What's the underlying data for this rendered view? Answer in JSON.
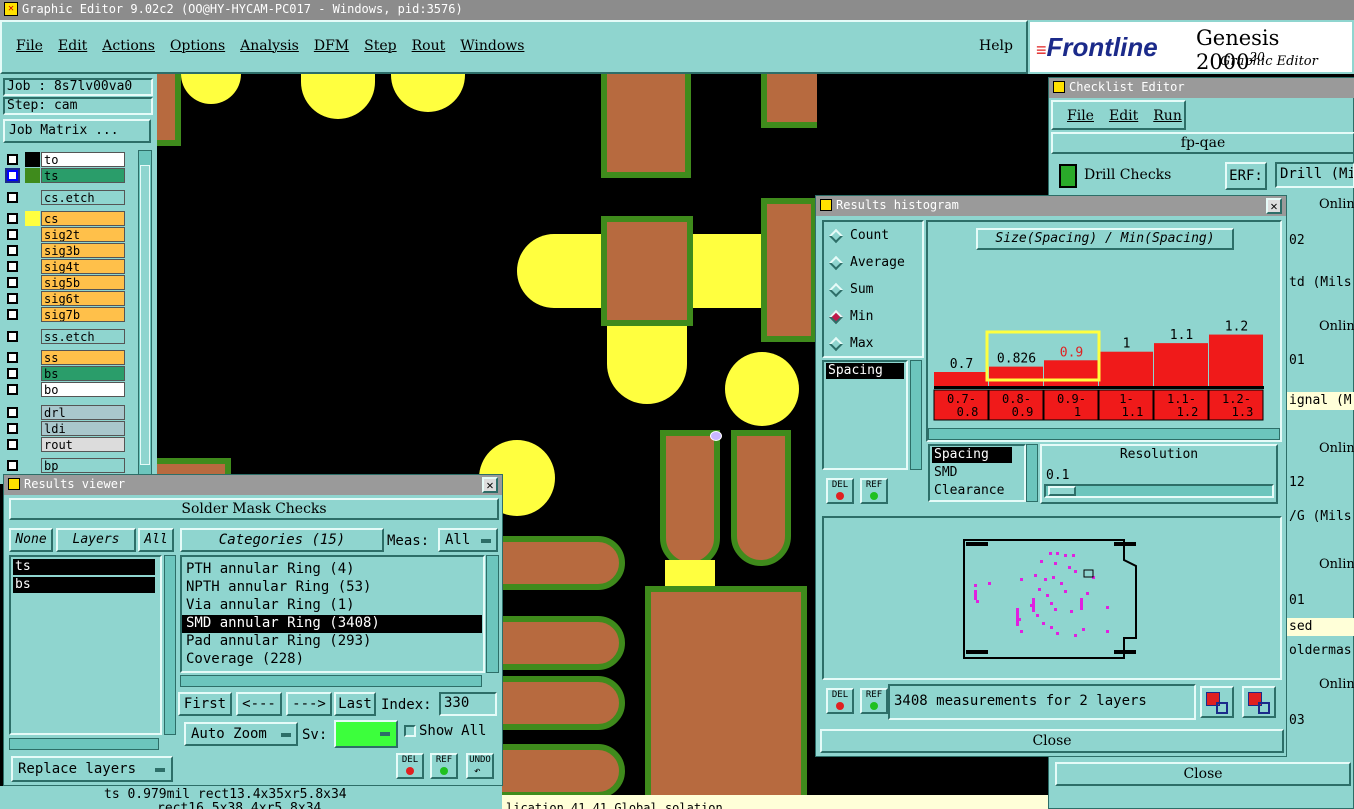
{
  "window_title": "Graphic Editor 9.02c2 (OO@HY-HYCAM-PC017 - Windows, pid:3576)",
  "menu": [
    "File",
    "Edit",
    "Actions",
    "Options",
    "Analysis",
    "DFM",
    "Step",
    "Rout",
    "Windows"
  ],
  "help": "Help",
  "brand": {
    "logo": "Frontline",
    "product": "Genesis 2000",
    "version": "20",
    "subtitle": "Graphic Editor"
  },
  "job": {
    "label": "Job : 8s7lv00va0",
    "step": "Step: cam",
    "matrix_button": "Job Matrix ..."
  },
  "layers": [
    {
      "name": "to",
      "color": "#ffffff",
      "swatch": "#000000"
    },
    {
      "name": "ts",
      "color": "#2a9d6a",
      "swatch": "#3f8b1c"
    },
    {
      "name": "cs.etch",
      "color": "#8fd5cf",
      "swatch": ""
    },
    {
      "name": "cs",
      "color": "#ffc04a",
      "swatch": "#ffff3f"
    },
    {
      "name": "sig2t",
      "color": "#ffc04a",
      "swatch": ""
    },
    {
      "name": "sig3b",
      "color": "#ffc04a",
      "swatch": ""
    },
    {
      "name": "sig4t",
      "color": "#ffc04a",
      "swatch": ""
    },
    {
      "name": "sig5b",
      "color": "#ffc04a",
      "swatch": ""
    },
    {
      "name": "sig6t",
      "color": "#ffc04a",
      "swatch": ""
    },
    {
      "name": "sig7b",
      "color": "#ffc04a",
      "swatch": ""
    },
    {
      "name": "ss.etch",
      "color": "#8fd5cf",
      "swatch": ""
    },
    {
      "name": "ss",
      "color": "#ffc04a",
      "swatch": ""
    },
    {
      "name": "bs",
      "color": "#2a9d6a",
      "swatch": ""
    },
    {
      "name": "bo",
      "color": "#ffffff",
      "swatch": ""
    },
    {
      "name": "drl",
      "color": "#a9c7cc",
      "swatch": ""
    },
    {
      "name": "ldi",
      "color": "#a9c7cc",
      "swatch": ""
    },
    {
      "name": "rout",
      "color": "#dcdcdc",
      "swatch": ""
    },
    {
      "name": "bp",
      "color": "#8fd5cf",
      "swatch": ""
    }
  ],
  "results_viewer": {
    "title": "Results viewer",
    "header": "Solder Mask Checks",
    "none_btn": "None",
    "layers_btn": "Layers",
    "all_btn": "All",
    "layer_list": [
      "ts",
      "bs"
    ],
    "categories_btn": "Categories (15)",
    "meas_label": "Meas:",
    "meas_value": "All",
    "categories": [
      "PTH annular Ring (4)",
      "NPTH annular Ring (53)",
      "Via annular Ring (1)",
      "SMD annular Ring (3408)",
      "Pad annular Ring (293)",
      "Coverage (228)"
    ],
    "selected_category": 3,
    "first": "First",
    "prev": "<---",
    "next": "--->",
    "last": "Last",
    "index_label": "Index:",
    "index_value": "330",
    "auto_zoom": "Auto Zoom",
    "sv_label": "Sv:",
    "show_all": "Show All",
    "replace_layers": "Replace layers",
    "del": "DEL",
    "ref": "REF",
    "undo": "UNDO"
  },
  "status": {
    "line1": "ts 0.979mil  rect13.4x35xr5.8x34",
    "line2": "rect16.5x38.4xr5.8x34",
    "bottom": "lication 41.41 Global solation"
  },
  "checklist": {
    "title": "Checklist Editor",
    "menu": [
      "File",
      "Edit",
      "Run"
    ],
    "name": "fp-qae",
    "drill_checks": "Drill Checks",
    "erf_label": "ERF:",
    "erf_value": "Drill (Mi",
    "side_labels": [
      "Onlin",
      "02",
      "td (Mils",
      "Onlin",
      "01",
      "ignal (M",
      "Onlin",
      "12",
      "/G (Mils",
      "Onlin",
      "01",
      "sed",
      "oldermas",
      "Onlin",
      "03"
    ],
    "close": "Close"
  },
  "histogram": {
    "title": "Results histogram",
    "modes": [
      "Count",
      "Average",
      "Sum",
      "Min",
      "Max"
    ],
    "selected_mode": "Min",
    "chart_title": "Size(Spacing) / Min(Spacing)",
    "measure_list": [
      "Spacing"
    ],
    "type_list": [
      "Spacing",
      "SMD",
      "Clearance"
    ],
    "resolution_label": "Resolution",
    "resolution_value": "0.1",
    "summary": "3408 measurements for 2 layers",
    "close": "Close",
    "del": "DEL",
    "ref": "REF"
  },
  "chart_data": {
    "type": "bar",
    "title": "Size(Spacing) / Min(Spacing)",
    "categories": [
      "0.7-0.8",
      "0.8-0.9",
      "0.9-1",
      "1-1.1",
      "1.1-1.2",
      "1.2-1.3"
    ],
    "value_labels": [
      "0.7",
      "0.826",
      "0.9",
      "1",
      "1.1",
      "1.2"
    ],
    "values": [
      0.7,
      0.826,
      0.9,
      1.0,
      1.1,
      1.2
    ],
    "highlighted": [
      1,
      2
    ],
    "bar_color": "#f01a1a"
  },
  "colors": {
    "panel": "#8fd5cf",
    "copper": "#b76a3f",
    "mask": "#3f8b1c",
    "pad": "#ffff3f"
  }
}
